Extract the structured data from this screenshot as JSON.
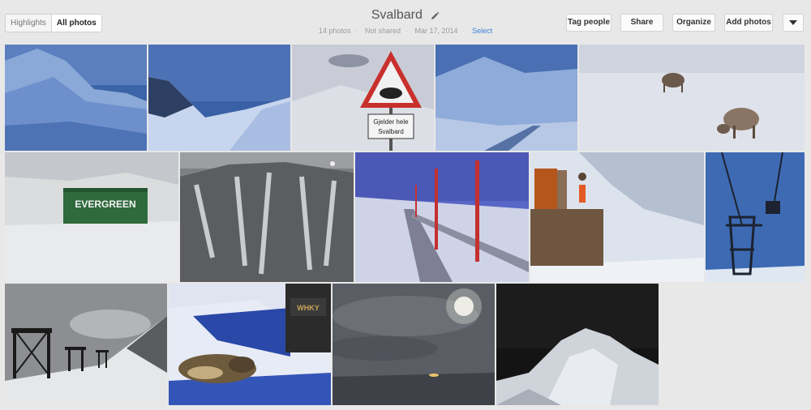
{
  "tabs": [
    {
      "label": "Highlights",
      "active": false
    },
    {
      "label": "All photos",
      "active": true
    }
  ],
  "album": {
    "title": "Svalbard",
    "photo_count": "14 photos",
    "sharing": "Not shared",
    "date": "Mar 17, 2014",
    "select_label": "Select"
  },
  "toolbar": {
    "tag_people": "Tag people",
    "share": "Share",
    "organize": "Organize",
    "add_photos": "Add photos",
    "more_icon": "chevron-down-icon"
  },
  "photos": {
    "p7": {
      "container_text": "EVERGREEN"
    },
    "p3": {
      "sign_line1": "Gjelder hele",
      "sign_line2": "Svalbard"
    },
    "p12": {
      "box_text": "WHKY"
    }
  },
  "colors": {
    "background": "#e8e8e8",
    "link": "#3b7fd4"
  }
}
